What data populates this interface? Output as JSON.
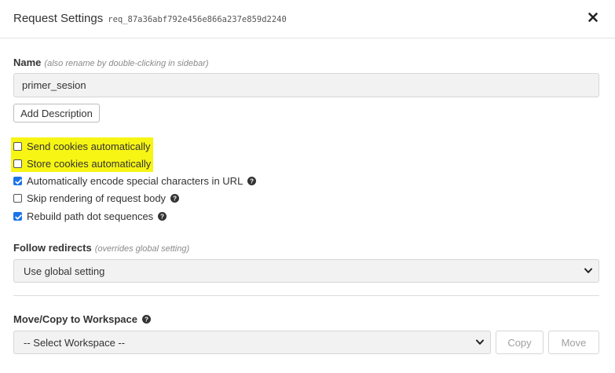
{
  "modal": {
    "title": "Request Settings",
    "request_id": "req_87a36abf792e456e866a237e859d2240",
    "close_label": "×"
  },
  "name_field": {
    "label": "Name",
    "hint": "(also rename by double-clicking in sidebar)",
    "value": "primer_sesion",
    "add_description_label": "Add Description"
  },
  "options": [
    {
      "label": "Send cookies automatically",
      "checked": false,
      "highlighted": true,
      "help": false
    },
    {
      "label": "Store cookies automatically",
      "checked": false,
      "highlighted": true,
      "help": false
    },
    {
      "label": "Automatically encode special characters in URL",
      "checked": true,
      "highlighted": false,
      "help": true
    },
    {
      "label": "Skip rendering of request body",
      "checked": false,
      "highlighted": false,
      "help": true
    },
    {
      "label": "Rebuild path dot sequences",
      "checked": true,
      "highlighted": false,
      "help": true
    }
  ],
  "redirects": {
    "label": "Follow redirects",
    "hint": "(overrides global setting)",
    "selected": "Use global setting"
  },
  "workspace": {
    "label": "Move/Copy to Workspace",
    "selected": "-- Select Workspace --",
    "copy_label": "Copy",
    "move_label": "Move"
  },
  "colors": {
    "highlight": "#f7f514",
    "checkbox_checked": "#1a73e8"
  }
}
